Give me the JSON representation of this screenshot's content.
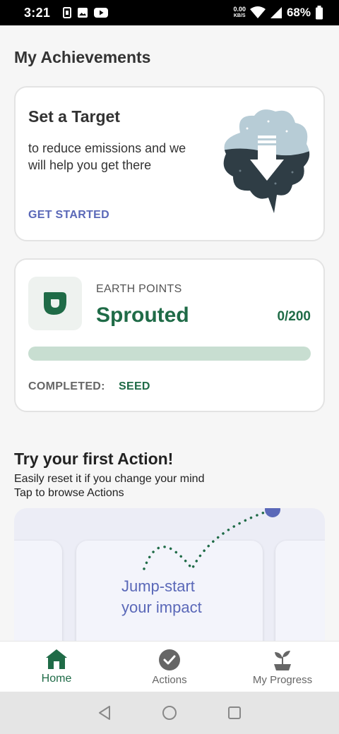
{
  "status_bar": {
    "time": "3:21",
    "net_speed_value": "0.00",
    "net_speed_unit": "KB/S",
    "battery": "68%"
  },
  "page": {
    "title": "My Achievements"
  },
  "target_card": {
    "title": "Set a Target",
    "description": "to reduce emissions and we will help you get there",
    "cta": "GET STARTED"
  },
  "points_card": {
    "label": "EARTH POINTS",
    "level": "Sprouted",
    "count": "0/200",
    "progress": 0,
    "completed_label": "COMPLETED:",
    "completed_value": "SEED"
  },
  "action_section": {
    "title": "Try your first Action!",
    "subtitle_line1": "Easily reset it if you change your mind",
    "subtitle_line2": "Tap to browse Actions",
    "card_text_line1": "Jump-start",
    "card_text_line2": "your impact"
  },
  "bottom_nav": {
    "items": [
      {
        "label": "Home",
        "icon": "home-icon",
        "active": true
      },
      {
        "label": "Actions",
        "icon": "check-circle-icon",
        "active": false
      },
      {
        "label": "My Progress",
        "icon": "sprout-icon",
        "active": false
      }
    ]
  },
  "colors": {
    "brand_green": "#1f6b47",
    "accent_blue": "#5a68b8",
    "progress_track": "#c8ded1"
  }
}
